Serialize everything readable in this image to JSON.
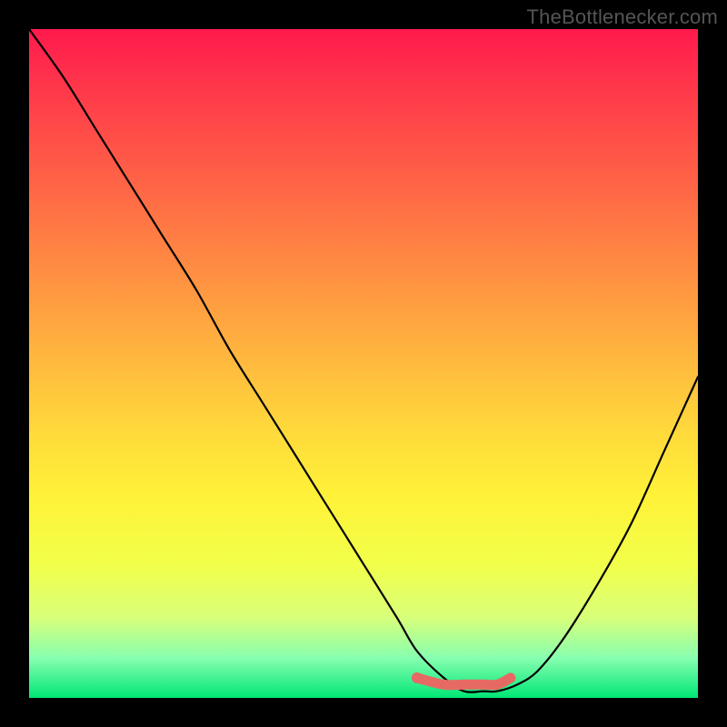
{
  "watermark": "TheBottlenecker.com",
  "colors": {
    "curve": "#000000",
    "marker": "#e66a63",
    "plot_border": "#000000"
  },
  "chart_data": {
    "type": "line",
    "title": "",
    "xlabel": "",
    "ylabel": "",
    "xlim": [
      0,
      100
    ],
    "ylim": [
      0,
      100
    ],
    "series": [
      {
        "name": "curve",
        "x": [
          0,
          5,
          10,
          15,
          20,
          25,
          30,
          35,
          40,
          45,
          50,
          55,
          58,
          62,
          65,
          68,
          70,
          73,
          76,
          80,
          85,
          90,
          95,
          100
        ],
        "values": [
          100,
          93,
          85,
          77,
          69,
          61,
          52,
          44,
          36,
          28,
          20,
          12,
          7,
          3,
          1,
          1,
          1,
          2,
          4,
          9,
          17,
          26,
          37,
          48
        ]
      },
      {
        "name": "flat-region-marker",
        "x": [
          58,
          62,
          65,
          68,
          70,
          72
        ],
        "values": [
          3,
          2,
          2,
          2,
          2,
          3
        ]
      }
    ],
    "notes": "Axes are unlabeled; values estimated from pixel positions. Background is a vertical red→yellow→green gradient. Black frame surrounds plot."
  }
}
